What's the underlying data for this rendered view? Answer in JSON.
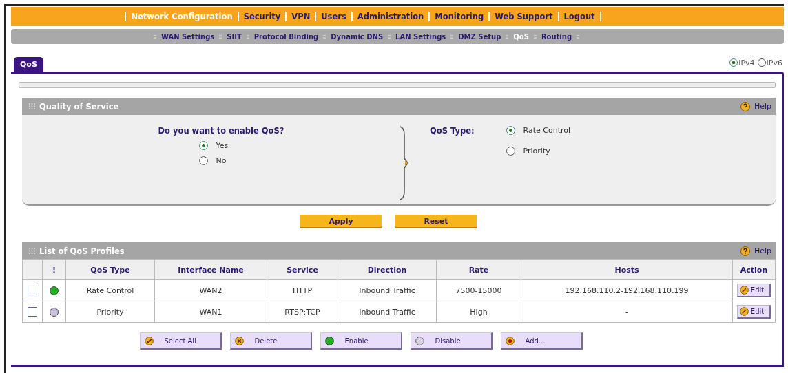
{
  "main_nav": [
    {
      "label": "Network Configuration",
      "selected": true
    },
    {
      "label": "Security",
      "selected": false
    },
    {
      "label": "VPN",
      "selected": false
    },
    {
      "label": "Users",
      "selected": false
    },
    {
      "label": "Administration",
      "selected": false
    },
    {
      "label": "Monitoring",
      "selected": false
    },
    {
      "label": "Web Support",
      "selected": false
    },
    {
      "label": "Logout",
      "selected": false
    }
  ],
  "sub_nav": [
    {
      "label": "WAN Settings",
      "selected": false
    },
    {
      "label": "SIIT",
      "selected": false
    },
    {
      "label": "Protocol Binding",
      "selected": false
    },
    {
      "label": "Dynamic DNS",
      "selected": false
    },
    {
      "label": "LAN Settings",
      "selected": false
    },
    {
      "label": "DMZ Setup",
      "selected": false
    },
    {
      "label": "QoS",
      "selected": true
    },
    {
      "label": "Routing",
      "selected": false
    }
  ],
  "tab": {
    "label": "QoS",
    "selected": true
  },
  "ip_version": [
    {
      "label": "IPv4",
      "selected": true
    },
    {
      "label": "IPv6",
      "selected": false
    }
  ],
  "qos_section": {
    "title": "Quality of Service",
    "help": "Help",
    "enable_question": "Do you want to enable QoS?",
    "enable_options": [
      {
        "label": "Yes",
        "selected": true
      },
      {
        "label": "No",
        "selected": false
      }
    ],
    "type_label": "QoS Type:",
    "type_options": [
      {
        "label": "Rate Control",
        "selected": true
      },
      {
        "label": "Priority",
        "selected": false
      }
    ]
  },
  "form_buttons": [
    "Apply",
    "Reset"
  ],
  "profiles": {
    "title": "List of QoS Profiles",
    "help": "Help",
    "columns": [
      "!",
      "QoS Type",
      "Interface Name",
      "Service",
      "Direction",
      "Rate",
      "Hosts",
      "Action"
    ],
    "rows": [
      {
        "checked": false,
        "color": "#22b022",
        "qos_type": "Rate Control",
        "interface": "WAN2",
        "service": "HTTP",
        "direction": "Inbound Traffic",
        "rate": "7500-15000",
        "hosts": "192.168.110.2-192.168.110.199",
        "action": "Edit"
      },
      {
        "checked": false,
        "color": "#c8c0dc",
        "qos_type": "Priority",
        "interface": "WAN1",
        "service": "RTSP:TCP",
        "direction": "Inbound Traffic",
        "rate": "High",
        "hosts": "-",
        "action": "Edit"
      }
    ],
    "buttons": [
      {
        "kind": "check",
        "label": "Select All"
      },
      {
        "kind": "cross",
        "label": "Delete"
      },
      {
        "kind": "enable",
        "label": "Enable"
      },
      {
        "kind": "disable",
        "label": "Disable"
      },
      {
        "kind": "add",
        "label": "Add..."
      }
    ]
  }
}
